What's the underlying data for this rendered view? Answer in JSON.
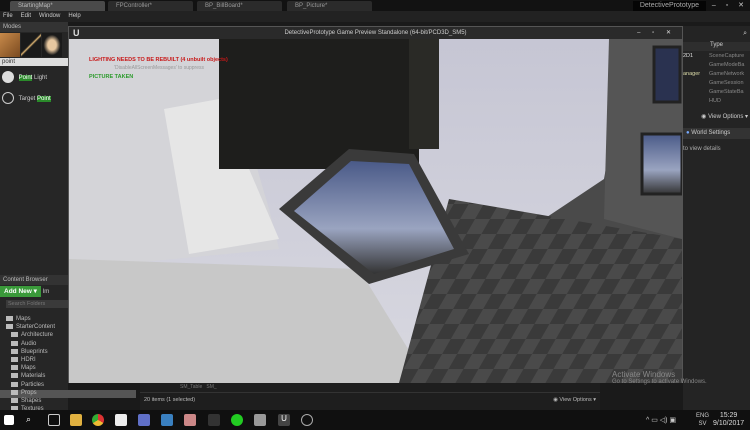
{
  "tabs": [
    "StartingMap*",
    "FPController*",
    "BP_BillBoard*",
    "BP_Picture*"
  ],
  "project_name": "DetectivePrototype",
  "window_controls": "– ▫ ✕",
  "menu": [
    "File",
    "Edit",
    "Window",
    "Help"
  ],
  "modes": {
    "title": "Modes",
    "search_value": "point",
    "items": [
      {
        "pre": "",
        "hl": "Point",
        "post": " Light"
      },
      {
        "pre": "Target ",
        "hl": "Point",
        "post": ""
      }
    ]
  },
  "content_browser": {
    "title": "Content Browser",
    "add_new": "Add New ▾",
    "import": "Im",
    "search_placeholder": "Search Folders",
    "folders": [
      "Maps",
      "StarterContent",
      "Architecture",
      "Audio",
      "Blueprints",
      "HDRI",
      "Maps",
      "Materials",
      "Particles",
      "Props",
      "Shapes",
      "Textures"
    ],
    "items_status": "20 items (1 selected)",
    "view_options": "View Options ▾",
    "asset_labels": [
      "SM_Table",
      "SM_"
    ]
  },
  "game_window": {
    "title": "DetectivePrototype Game Preview Standalone (64-bit/PCD3D_SM5)",
    "msg_lighting": "LIGHTING NEEDS TO BE REBUILT (4 unbuilt objects)",
    "msg_disable": "'DisableAllScreenMessages' to suppress",
    "msg_picture": "PICTURE TAKEN"
  },
  "outliner": {
    "type_header": "Type",
    "rows": [
      {
        "name": "2D1",
        "type": "SceneCapture"
      },
      {
        "name": "",
        "type": "GameModeBa"
      },
      {
        "name": "anager",
        "type": "GameNetwork"
      },
      {
        "name": "",
        "type": "GameSession"
      },
      {
        "name": "",
        "type": "GameStateBa"
      },
      {
        "name": "",
        "type": "HUD"
      }
    ],
    "view_options": "View Options ▾"
  },
  "world_settings": {
    "title": "World Settings",
    "hint": "to view details"
  },
  "activate": {
    "title": "Activate Windows",
    "sub": "Go to Settings to activate Windows."
  },
  "tray": {
    "lang": "ENG",
    "region": "SV",
    "time": "15:29",
    "date": "9/10/2017"
  }
}
